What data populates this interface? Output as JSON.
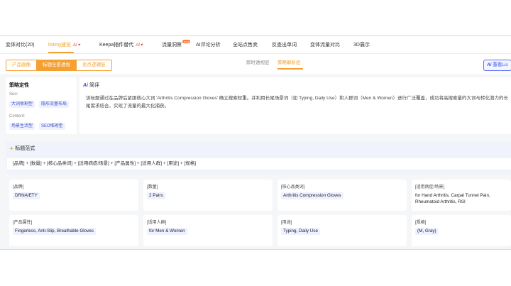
{
  "tabs": [
    {
      "label": "变体对比(20)"
    },
    {
      "label": "listing速览",
      "ai": "AI✦"
    },
    {
      "label": "Keepa插件替代",
      "ai": "AI✦"
    },
    {
      "label": "流量洞察",
      "badge": "new"
    },
    {
      "label": "AI评论分析"
    },
    {
      "label": "全站点售卖"
    },
    {
      "label": "反查出单词"
    },
    {
      "label": "变体流量对比"
    },
    {
      "label": "3D展示"
    }
  ],
  "segment": {
    "items": [
      "产品画像",
      "标题全景透视",
      "卖点逻辑链"
    ],
    "active": 1
  },
  "view_tabs": {
    "items": [
      "即时透视层",
      "策略解析层"
    ],
    "active": 1
  },
  "ai_button": {
    "icon": "Ai",
    "label": "重看Lis"
  },
  "strategy": {
    "title": "策略定性",
    "seo_label": "Seo:",
    "seo_chips": [
      "大词收割型",
      "隐形流量布局"
    ],
    "content_label": "Content:",
    "content_chips": [
      "场景生活型",
      "SEO堆砌型"
    ]
  },
  "intro": {
    "icon": "Ai",
    "title": "简评",
    "text": "该标题通过在品牌后紧跟核心大词 'Arthritis Compression Gloves' 确立搜索权重。并利用长尾场景词（如 Typing, Daily Use）和人群词（Men & Women）进行广泛覆盖，成功将高搜索量的大词与转化潜力的长尾需求结合，实现了流量的最大化捕获。"
  },
  "formula": {
    "title": "标题范式",
    "text": "[品牌] + [数量] + [核心品类词] + [适用病症/场景] + [产品属性] + [适用人群] + [用途] + [规格]"
  },
  "attributes": [
    {
      "label": "[品牌]",
      "value": "DRNAIETY"
    },
    {
      "label": "[数量]",
      "value": "2 Pairs"
    },
    {
      "label": "[核心品类词]",
      "value": "Arthritis Compression Gloves"
    },
    {
      "label": "[适用病症/场景]",
      "value": "for Hand Arthritis, Carpal Tunnel Pain, Rheumatoid Arthritis, RSI"
    },
    {
      "label": "[产品属性]",
      "value": "Fingerless, Anti-Slip, Breathable Gloves"
    },
    {
      "label": "[适用人群]",
      "value": "for Men & Women"
    },
    {
      "label": "[用途]",
      "value": "Typing, Daily Use"
    },
    {
      "label": "[规格]",
      "value": "(M, Gray)"
    }
  ],
  "colors": {
    "accent": "#f5a032",
    "ai_blue": "#3f53e8",
    "background": "#f5f6f8"
  }
}
